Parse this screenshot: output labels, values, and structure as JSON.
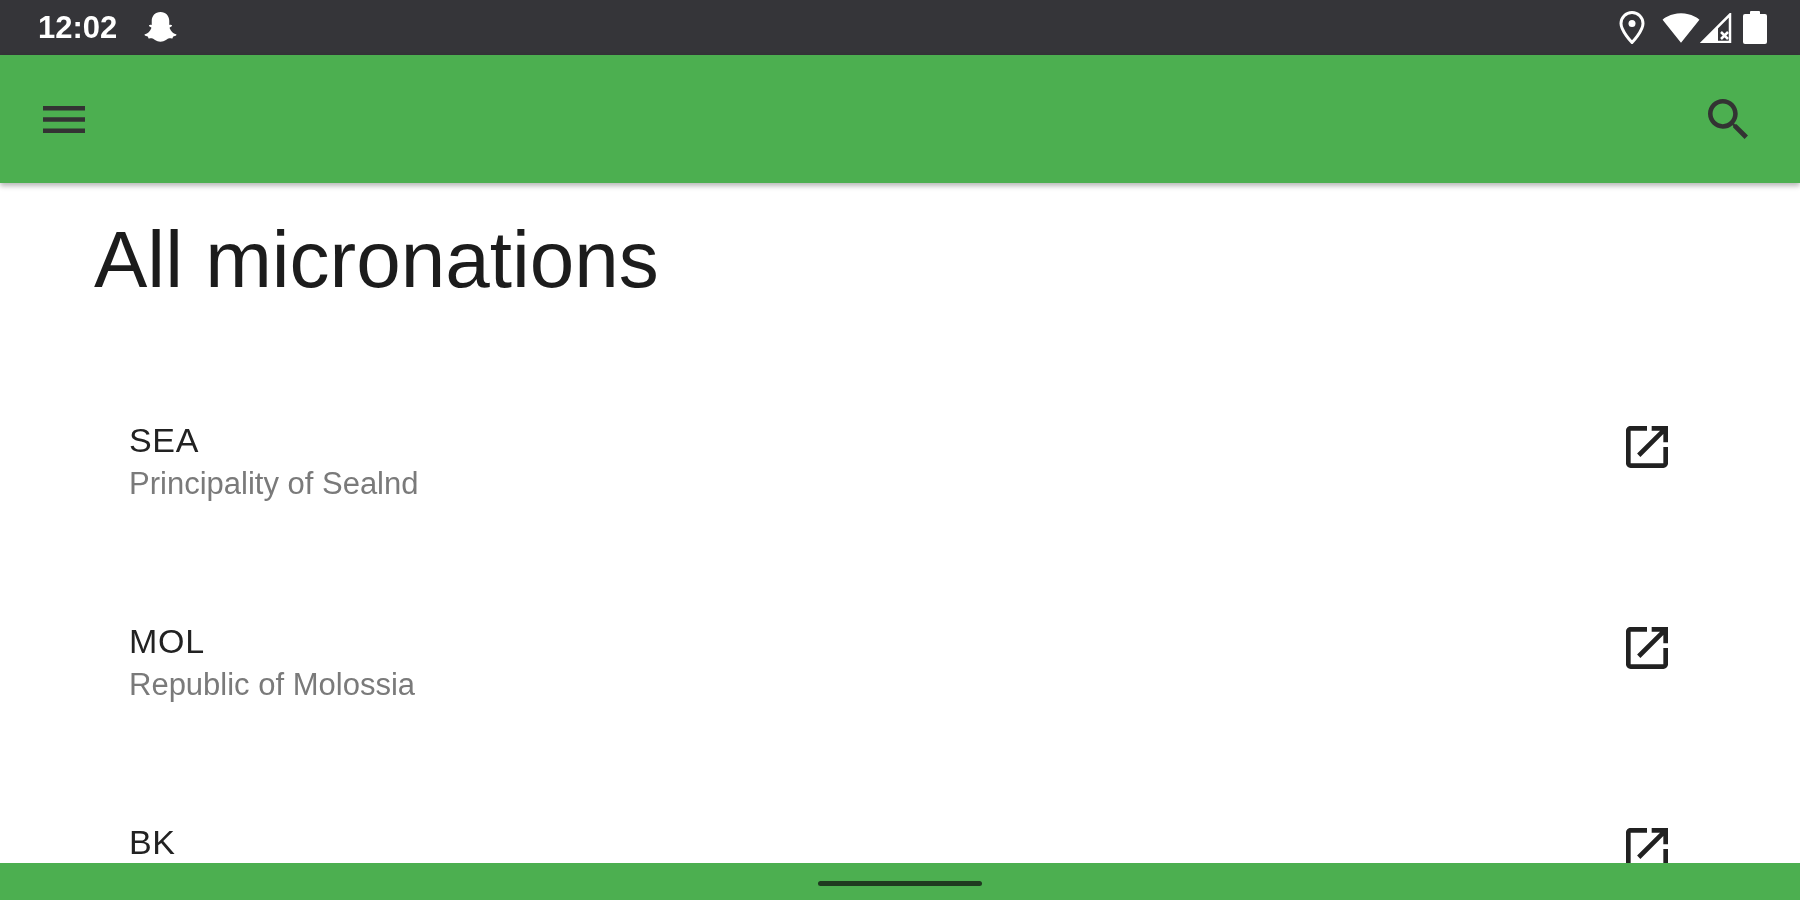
{
  "status_bar": {
    "time": "12:02"
  },
  "page": {
    "title": "All micronations"
  },
  "micronations": [
    {
      "code": "SEA",
      "name": "Principality of Sealnd"
    },
    {
      "code": "MOL",
      "name": "Republic of Molossia"
    },
    {
      "code": "BK"
    }
  ]
}
